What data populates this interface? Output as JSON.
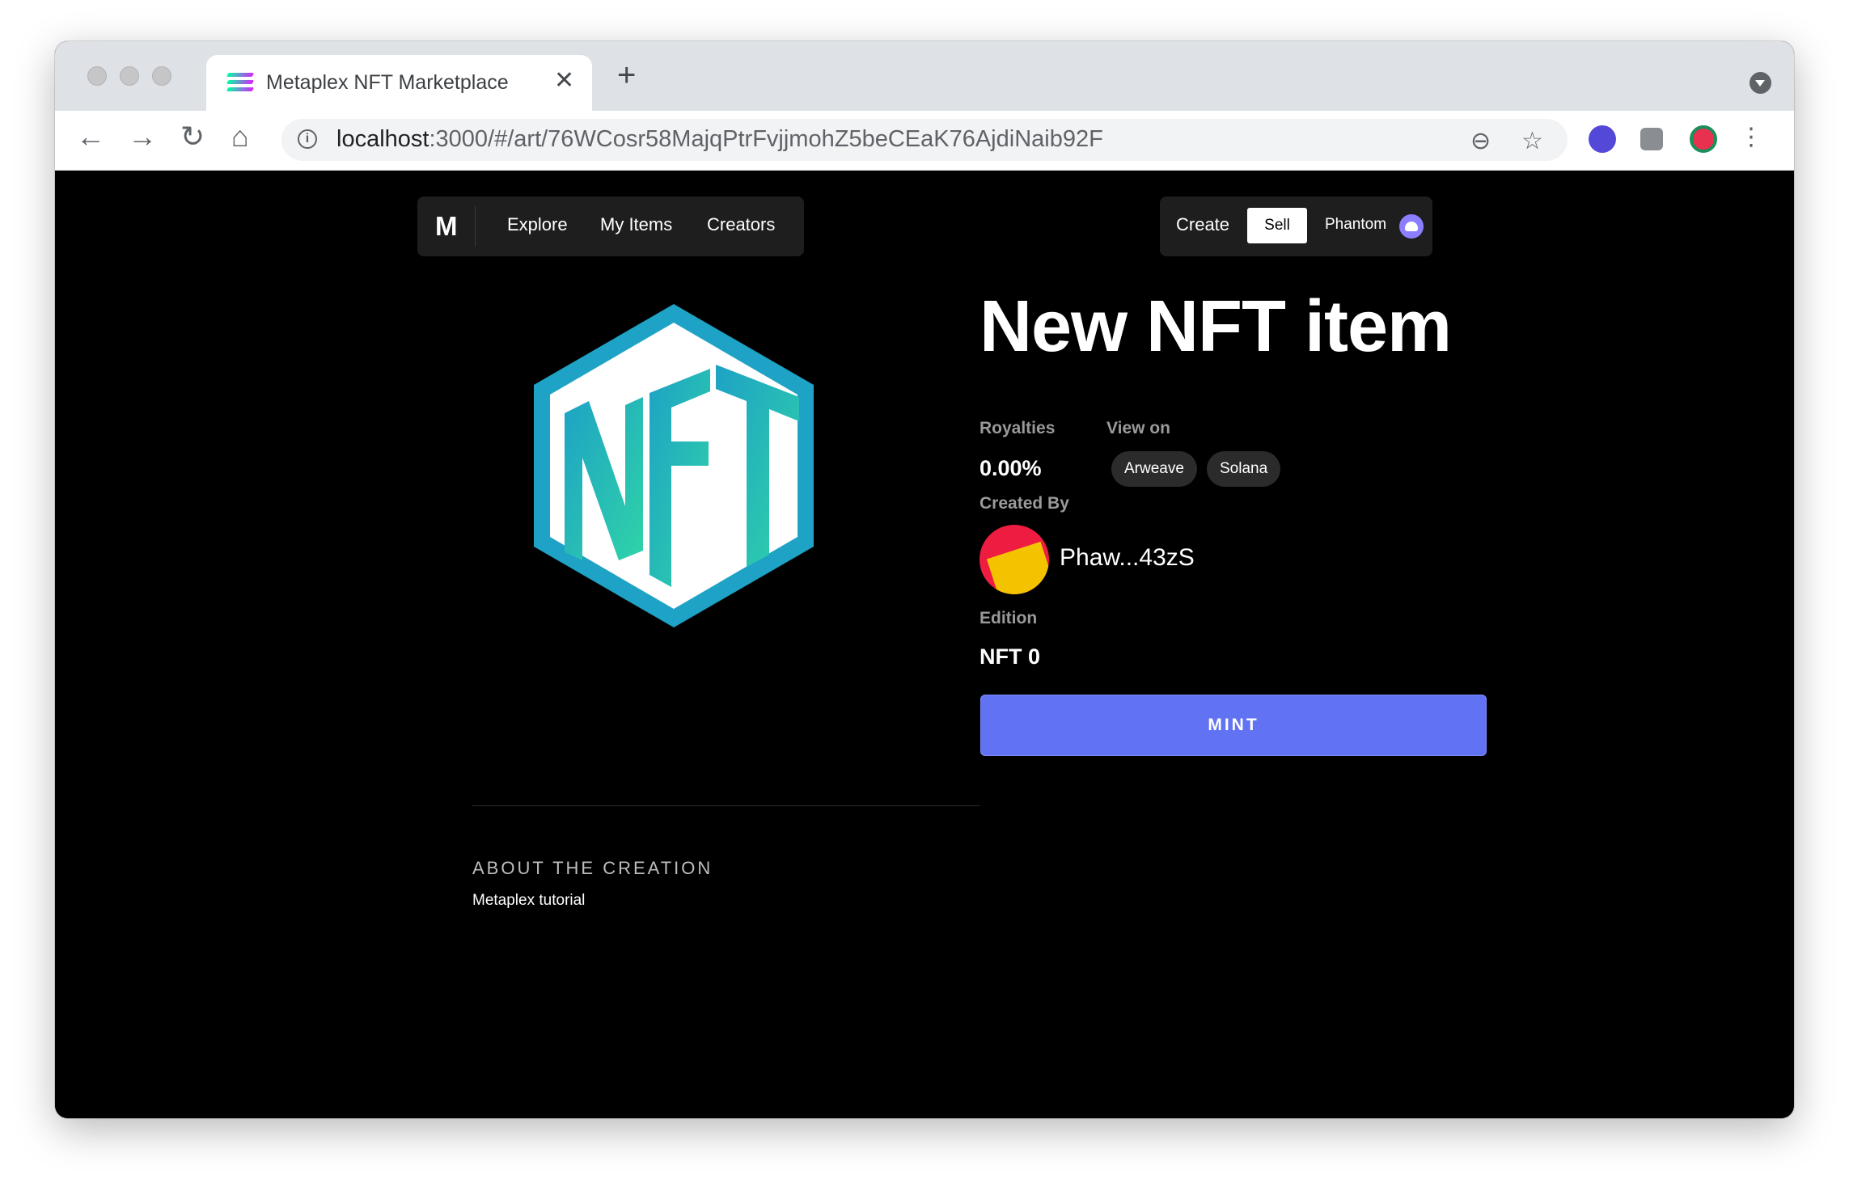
{
  "browser": {
    "tab_title": "Metaplex NFT Marketplace",
    "tab_close": "✕",
    "new_tab": "+",
    "url_host": "localhost",
    "url_rest": ":3000/#/art/76WCosr58MajqPtrFvjjmohZ5beCEaK76AjdiNaib92F",
    "nav_back": "←",
    "nav_forward": "→",
    "nav_reload": "↻",
    "nav_home": "⌂",
    "zoom_icon": "⊖",
    "bookmark_icon": "☆",
    "menu_icon": "⋮"
  },
  "header": {
    "logo": "M",
    "nav": [
      "Explore",
      "My Items",
      "Creators"
    ],
    "create": "Create",
    "sell": "Sell",
    "wallet": "Phantom"
  },
  "item": {
    "title": "New NFT item",
    "royalties_label": "Royalties",
    "royalties_value": "0.00%",
    "view_on_label": "View on",
    "view_on": [
      "Arweave",
      "Solana"
    ],
    "created_by_label": "Created By",
    "creator": "Phaw...43zS",
    "edition_label": "Edition",
    "edition_value": "NFT 0",
    "mint": "MINT",
    "about_heading": "ABOUT THE CREATION",
    "about_text": "Metaplex tutorial"
  },
  "colors": {
    "accent": "#6172f3",
    "nft_logo_teal": "#1ea2c5",
    "nft_logo_green": "#2fd3a8"
  }
}
